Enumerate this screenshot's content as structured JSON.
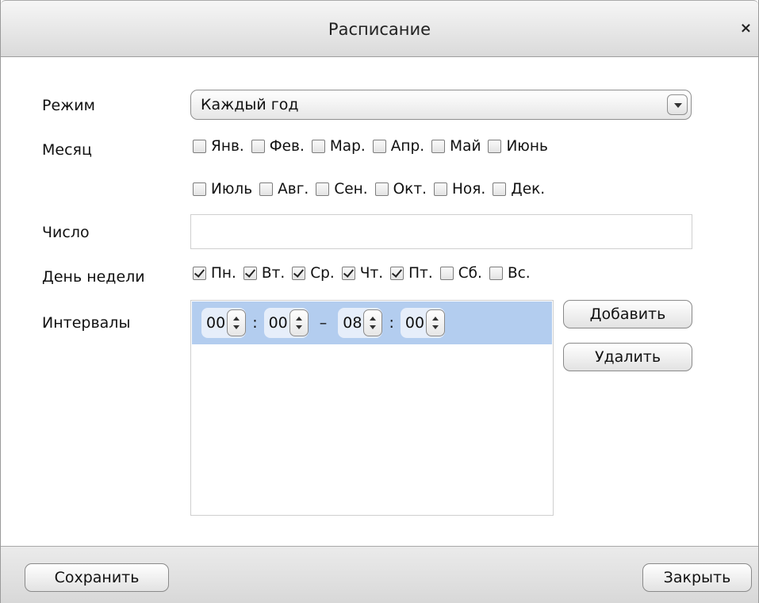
{
  "dialog": {
    "title": "Расписание",
    "close_glyph": "×"
  },
  "form": {
    "mode": {
      "label": "Режим",
      "value": "Каждый год"
    },
    "month": {
      "label": "Месяц",
      "items": [
        {
          "label": "Янв.",
          "checked": false
        },
        {
          "label": "Фев.",
          "checked": false
        },
        {
          "label": "Мар.",
          "checked": false
        },
        {
          "label": "Апр.",
          "checked": false
        },
        {
          "label": "Май",
          "checked": false
        },
        {
          "label": "Июнь",
          "checked": false
        },
        {
          "label": "Июль",
          "checked": false
        },
        {
          "label": "Авг.",
          "checked": false
        },
        {
          "label": "Сен.",
          "checked": false
        },
        {
          "label": "Окт.",
          "checked": false
        },
        {
          "label": "Ноя.",
          "checked": false
        },
        {
          "label": "Дек.",
          "checked": false
        }
      ]
    },
    "day_number": {
      "label": "Число",
      "value": ""
    },
    "weekday": {
      "label": "День недели",
      "items": [
        {
          "label": "Пн.",
          "checked": true
        },
        {
          "label": "Вт.",
          "checked": true
        },
        {
          "label": "Ср.",
          "checked": true
        },
        {
          "label": "Чт.",
          "checked": true
        },
        {
          "label": "Пт.",
          "checked": true
        },
        {
          "label": "Сб.",
          "checked": false
        },
        {
          "label": "Вс.",
          "checked": false
        }
      ]
    },
    "intervals": {
      "label": "Интервалы",
      "rows": [
        {
          "start_h": "00",
          "start_m": "00",
          "end_h": "08",
          "end_m": "00",
          "colon": ":",
          "dash": "–"
        }
      ],
      "add_label": "Добавить",
      "delete_label": "Удалить"
    }
  },
  "footer": {
    "save_label": "Сохранить",
    "close_label": "Закрыть"
  }
}
